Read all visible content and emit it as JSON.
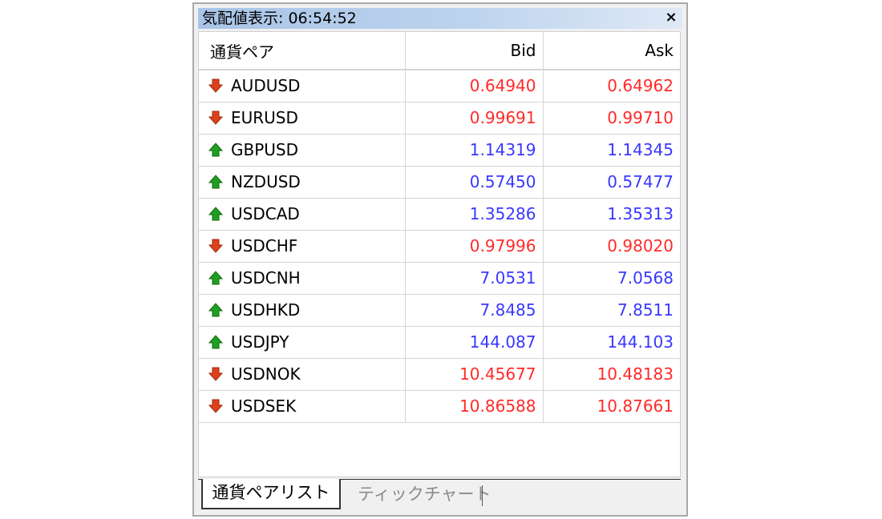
{
  "window": {
    "title": "気配値表示: 06:54:52",
    "close_glyph": "×"
  },
  "table": {
    "headers": {
      "symbol": "通貨ペア",
      "bid": "Bid",
      "ask": "Ask"
    },
    "rows": [
      {
        "symbol": "AUDUSD",
        "bid": "0.64940",
        "ask": "0.64962",
        "dir": "down"
      },
      {
        "symbol": "EURUSD",
        "bid": "0.99691",
        "ask": "0.99710",
        "dir": "down"
      },
      {
        "symbol": "GBPUSD",
        "bid": "1.14319",
        "ask": "1.14345",
        "dir": "up"
      },
      {
        "symbol": "NZDUSD",
        "bid": "0.57450",
        "ask": "0.57477",
        "dir": "up"
      },
      {
        "symbol": "USDCAD",
        "bid": "1.35286",
        "ask": "1.35313",
        "dir": "up"
      },
      {
        "symbol": "USDCHF",
        "bid": "0.97996",
        "ask": "0.98020",
        "dir": "down"
      },
      {
        "symbol": "USDCNH",
        "bid": "7.0531",
        "ask": "7.0568",
        "dir": "up"
      },
      {
        "symbol": "USDHKD",
        "bid": "7.8485",
        "ask": "7.8511",
        "dir": "up"
      },
      {
        "symbol": "USDJPY",
        "bid": "144.087",
        "ask": "144.103",
        "dir": "up"
      },
      {
        "symbol": "USDNOK",
        "bid": "10.45677",
        "ask": "10.48183",
        "dir": "down"
      },
      {
        "symbol": "USDSEK",
        "bid": "10.86588",
        "ask": "10.87661",
        "dir": "down"
      }
    ]
  },
  "tabs": [
    {
      "label": "通貨ペアリスト",
      "active": true
    },
    {
      "label": "ティックチャート",
      "active": false
    }
  ],
  "colors": {
    "down": "#ff2a2a",
    "up": "#3838ff",
    "arrow_down": "#e0401a",
    "arrow_up": "#1fa01f"
  },
  "icons": {
    "down": "arrow-down-icon",
    "up": "arrow-up-icon"
  }
}
